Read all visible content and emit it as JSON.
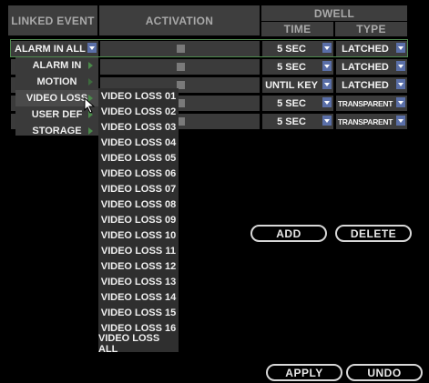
{
  "header": {
    "linked_event": "LINKED EVENT",
    "activation": "ACTIVATION",
    "dwell": "DWELL",
    "time": "TIME",
    "type": "TYPE"
  },
  "rows": [
    {
      "event": "ALARM IN ALL",
      "time": "5 SEC",
      "type": "LATCHED"
    },
    {
      "event": "",
      "time": "5 SEC",
      "type": "LATCHED"
    },
    {
      "event": "",
      "time": "UNTIL KEY",
      "type": "LATCHED"
    },
    {
      "event": "",
      "time": "5 SEC",
      "type": "TRANSPARENT"
    },
    {
      "event": "",
      "time": "5 SEC",
      "type": "TRANSPARENT"
    }
  ],
  "menu_primary": [
    "ALARM IN",
    "MOTION",
    "VIDEO LOSS",
    "USER DEF",
    "STORAGE"
  ],
  "menu_video_loss": [
    "VIDEO LOSS 01",
    "VIDEO LOSS 02",
    "VIDEO LOSS 03",
    "VIDEO LOSS 04",
    "VIDEO LOSS 05",
    "VIDEO LOSS 06",
    "VIDEO LOSS 07",
    "VIDEO LOSS 08",
    "VIDEO LOSS 09",
    "VIDEO LOSS 10",
    "VIDEO LOSS 11",
    "VIDEO LOSS 12",
    "VIDEO LOSS 13",
    "VIDEO LOSS 14",
    "VIDEO LOSS 15",
    "VIDEO LOSS 16",
    "VIDEO LOSS ALL"
  ],
  "buttons": {
    "add": "ADD",
    "delete": "DELETE",
    "apply": "APPLY",
    "undo": "UNDO"
  }
}
